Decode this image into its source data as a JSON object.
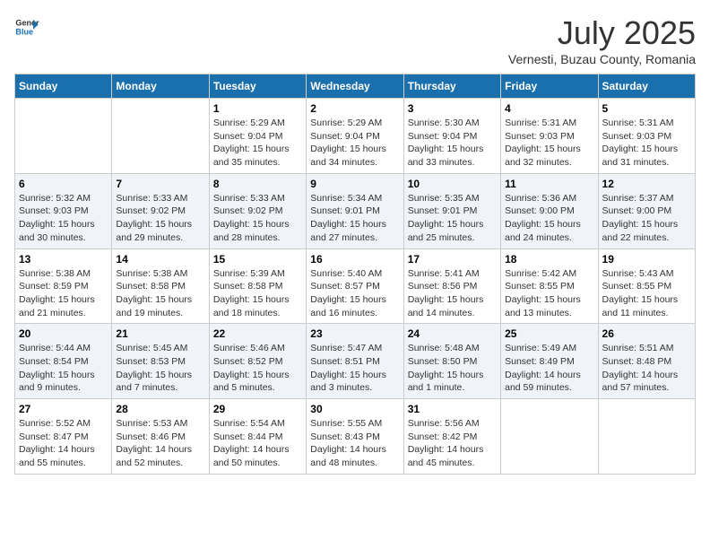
{
  "header": {
    "logo_general": "General",
    "logo_blue": "Blue",
    "month": "July 2025",
    "location": "Vernesti, Buzau County, Romania"
  },
  "days_of_week": [
    "Sunday",
    "Monday",
    "Tuesday",
    "Wednesday",
    "Thursday",
    "Friday",
    "Saturday"
  ],
  "weeks": [
    [
      {
        "day": "",
        "info": ""
      },
      {
        "day": "",
        "info": ""
      },
      {
        "day": "1",
        "info": "Sunrise: 5:29 AM\nSunset: 9:04 PM\nDaylight: 15 hours and 35 minutes."
      },
      {
        "day": "2",
        "info": "Sunrise: 5:29 AM\nSunset: 9:04 PM\nDaylight: 15 hours and 34 minutes."
      },
      {
        "day": "3",
        "info": "Sunrise: 5:30 AM\nSunset: 9:04 PM\nDaylight: 15 hours and 33 minutes."
      },
      {
        "day": "4",
        "info": "Sunrise: 5:31 AM\nSunset: 9:03 PM\nDaylight: 15 hours and 32 minutes."
      },
      {
        "day": "5",
        "info": "Sunrise: 5:31 AM\nSunset: 9:03 PM\nDaylight: 15 hours and 31 minutes."
      }
    ],
    [
      {
        "day": "6",
        "info": "Sunrise: 5:32 AM\nSunset: 9:03 PM\nDaylight: 15 hours and 30 minutes."
      },
      {
        "day": "7",
        "info": "Sunrise: 5:33 AM\nSunset: 9:02 PM\nDaylight: 15 hours and 29 minutes."
      },
      {
        "day": "8",
        "info": "Sunrise: 5:33 AM\nSunset: 9:02 PM\nDaylight: 15 hours and 28 minutes."
      },
      {
        "day": "9",
        "info": "Sunrise: 5:34 AM\nSunset: 9:01 PM\nDaylight: 15 hours and 27 minutes."
      },
      {
        "day": "10",
        "info": "Sunrise: 5:35 AM\nSunset: 9:01 PM\nDaylight: 15 hours and 25 minutes."
      },
      {
        "day": "11",
        "info": "Sunrise: 5:36 AM\nSunset: 9:00 PM\nDaylight: 15 hours and 24 minutes."
      },
      {
        "day": "12",
        "info": "Sunrise: 5:37 AM\nSunset: 9:00 PM\nDaylight: 15 hours and 22 minutes."
      }
    ],
    [
      {
        "day": "13",
        "info": "Sunrise: 5:38 AM\nSunset: 8:59 PM\nDaylight: 15 hours and 21 minutes."
      },
      {
        "day": "14",
        "info": "Sunrise: 5:38 AM\nSunset: 8:58 PM\nDaylight: 15 hours and 19 minutes."
      },
      {
        "day": "15",
        "info": "Sunrise: 5:39 AM\nSunset: 8:58 PM\nDaylight: 15 hours and 18 minutes."
      },
      {
        "day": "16",
        "info": "Sunrise: 5:40 AM\nSunset: 8:57 PM\nDaylight: 15 hours and 16 minutes."
      },
      {
        "day": "17",
        "info": "Sunrise: 5:41 AM\nSunset: 8:56 PM\nDaylight: 15 hours and 14 minutes."
      },
      {
        "day": "18",
        "info": "Sunrise: 5:42 AM\nSunset: 8:55 PM\nDaylight: 15 hours and 13 minutes."
      },
      {
        "day": "19",
        "info": "Sunrise: 5:43 AM\nSunset: 8:55 PM\nDaylight: 15 hours and 11 minutes."
      }
    ],
    [
      {
        "day": "20",
        "info": "Sunrise: 5:44 AM\nSunset: 8:54 PM\nDaylight: 15 hours and 9 minutes."
      },
      {
        "day": "21",
        "info": "Sunrise: 5:45 AM\nSunset: 8:53 PM\nDaylight: 15 hours and 7 minutes."
      },
      {
        "day": "22",
        "info": "Sunrise: 5:46 AM\nSunset: 8:52 PM\nDaylight: 15 hours and 5 minutes."
      },
      {
        "day": "23",
        "info": "Sunrise: 5:47 AM\nSunset: 8:51 PM\nDaylight: 15 hours and 3 minutes."
      },
      {
        "day": "24",
        "info": "Sunrise: 5:48 AM\nSunset: 8:50 PM\nDaylight: 15 hours and 1 minute."
      },
      {
        "day": "25",
        "info": "Sunrise: 5:49 AM\nSunset: 8:49 PM\nDaylight: 14 hours and 59 minutes."
      },
      {
        "day": "26",
        "info": "Sunrise: 5:51 AM\nSunset: 8:48 PM\nDaylight: 14 hours and 57 minutes."
      }
    ],
    [
      {
        "day": "27",
        "info": "Sunrise: 5:52 AM\nSunset: 8:47 PM\nDaylight: 14 hours and 55 minutes."
      },
      {
        "day": "28",
        "info": "Sunrise: 5:53 AM\nSunset: 8:46 PM\nDaylight: 14 hours and 52 minutes."
      },
      {
        "day": "29",
        "info": "Sunrise: 5:54 AM\nSunset: 8:44 PM\nDaylight: 14 hours and 50 minutes."
      },
      {
        "day": "30",
        "info": "Sunrise: 5:55 AM\nSunset: 8:43 PM\nDaylight: 14 hours and 48 minutes."
      },
      {
        "day": "31",
        "info": "Sunrise: 5:56 AM\nSunset: 8:42 PM\nDaylight: 14 hours and 45 minutes."
      },
      {
        "day": "",
        "info": ""
      },
      {
        "day": "",
        "info": ""
      }
    ]
  ]
}
